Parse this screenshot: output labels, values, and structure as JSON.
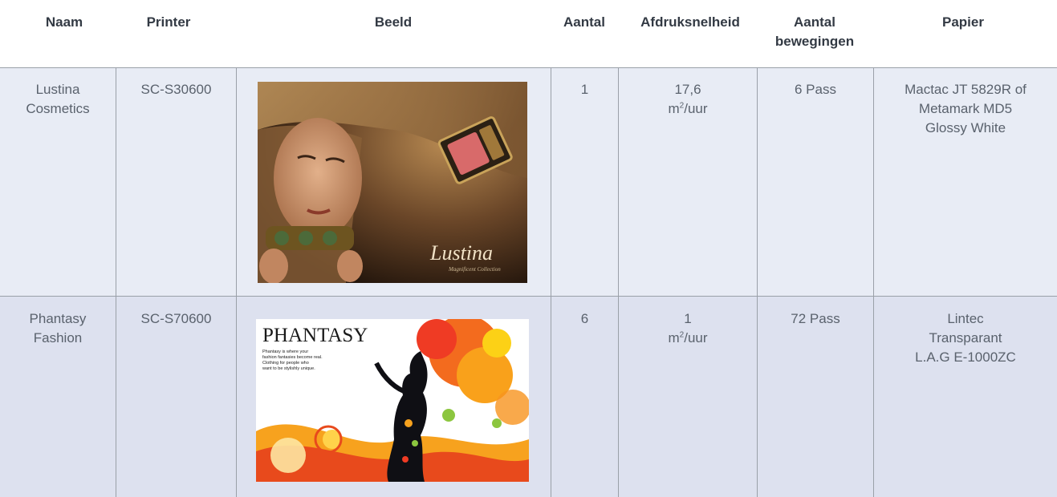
{
  "headers": {
    "naam": "Naam",
    "printer": "Printer",
    "beeld": "Beeld",
    "aantal": "Aantal",
    "snelheid": "Afdruksnelheid",
    "bewegingen_l1": "Aantal",
    "bewegingen_l2": "bewegingen",
    "papier": "Papier"
  },
  "rows": [
    {
      "naam_l1": "Lustina",
      "naam_l2": "Cosmetics",
      "printer": "SC-S30600",
      "aantal": "1",
      "snelheid_val": "17,6",
      "snelheid_unit_a": "m",
      "snelheid_unit_sup": "2",
      "snelheid_unit_b": "/uur",
      "bewegingen": "6 Pass",
      "papier_l1": "Mactac JT 5829R of",
      "papier_l2": "Metamark MD5",
      "papier_l3": "Glossy White",
      "image": {
        "brand": "Lustina",
        "tagline": "Magnificent Collection"
      }
    },
    {
      "naam_l1": "Phantasy",
      "naam_l2": "Fashion",
      "printer": "SC-S70600",
      "aantal": "6",
      "snelheid_val": "1",
      "snelheid_unit_a": "m",
      "snelheid_unit_sup": "2",
      "snelheid_unit_b": "/uur",
      "bewegingen": "72 Pass",
      "papier_l1": "Lintec",
      "papier_l2": "Transparant",
      "papier_l3": "L.A.G E-1000ZC",
      "image": {
        "brand": "PHANTASY",
        "copy_l1": "Phantasy is where your",
        "copy_l2": "fashion fantasies become real.",
        "copy_l3": "Clothing for people who",
        "copy_l4": "want to be stylishly unique."
      }
    }
  ]
}
